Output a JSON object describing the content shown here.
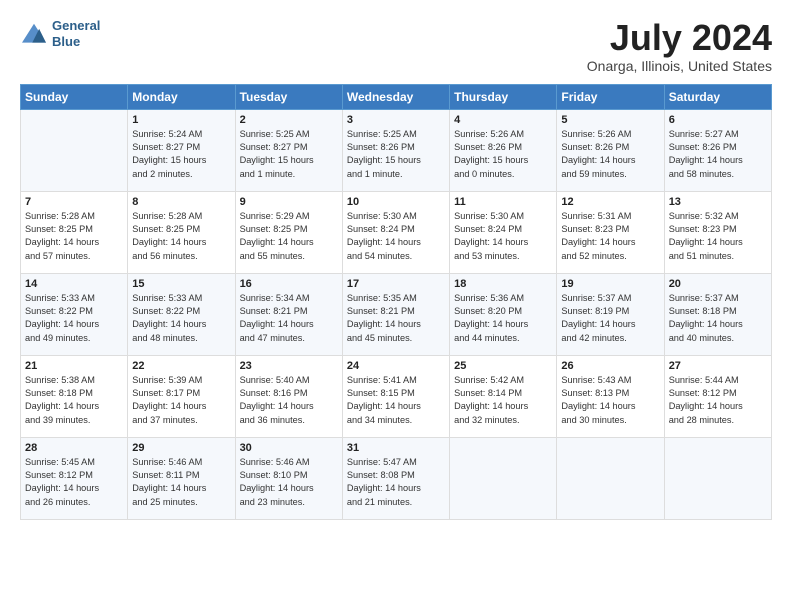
{
  "logo": {
    "line1": "General",
    "line2": "Blue"
  },
  "title": "July 2024",
  "subtitle": "Onarga, Illinois, United States",
  "days_header": [
    "Sunday",
    "Monday",
    "Tuesday",
    "Wednesday",
    "Thursday",
    "Friday",
    "Saturday"
  ],
  "weeks": [
    [
      {
        "day": "",
        "info": ""
      },
      {
        "day": "1",
        "info": "Sunrise: 5:24 AM\nSunset: 8:27 PM\nDaylight: 15 hours\nand 2 minutes."
      },
      {
        "day": "2",
        "info": "Sunrise: 5:25 AM\nSunset: 8:27 PM\nDaylight: 15 hours\nand 1 minute."
      },
      {
        "day": "3",
        "info": "Sunrise: 5:25 AM\nSunset: 8:26 PM\nDaylight: 15 hours\nand 1 minute."
      },
      {
        "day": "4",
        "info": "Sunrise: 5:26 AM\nSunset: 8:26 PM\nDaylight: 15 hours\nand 0 minutes."
      },
      {
        "day": "5",
        "info": "Sunrise: 5:26 AM\nSunset: 8:26 PM\nDaylight: 14 hours\nand 59 minutes."
      },
      {
        "day": "6",
        "info": "Sunrise: 5:27 AM\nSunset: 8:26 PM\nDaylight: 14 hours\nand 58 minutes."
      }
    ],
    [
      {
        "day": "7",
        "info": "Sunrise: 5:28 AM\nSunset: 8:25 PM\nDaylight: 14 hours\nand 57 minutes."
      },
      {
        "day": "8",
        "info": "Sunrise: 5:28 AM\nSunset: 8:25 PM\nDaylight: 14 hours\nand 56 minutes."
      },
      {
        "day": "9",
        "info": "Sunrise: 5:29 AM\nSunset: 8:25 PM\nDaylight: 14 hours\nand 55 minutes."
      },
      {
        "day": "10",
        "info": "Sunrise: 5:30 AM\nSunset: 8:24 PM\nDaylight: 14 hours\nand 54 minutes."
      },
      {
        "day": "11",
        "info": "Sunrise: 5:30 AM\nSunset: 8:24 PM\nDaylight: 14 hours\nand 53 minutes."
      },
      {
        "day": "12",
        "info": "Sunrise: 5:31 AM\nSunset: 8:23 PM\nDaylight: 14 hours\nand 52 minutes."
      },
      {
        "day": "13",
        "info": "Sunrise: 5:32 AM\nSunset: 8:23 PM\nDaylight: 14 hours\nand 51 minutes."
      }
    ],
    [
      {
        "day": "14",
        "info": "Sunrise: 5:33 AM\nSunset: 8:22 PM\nDaylight: 14 hours\nand 49 minutes."
      },
      {
        "day": "15",
        "info": "Sunrise: 5:33 AM\nSunset: 8:22 PM\nDaylight: 14 hours\nand 48 minutes."
      },
      {
        "day": "16",
        "info": "Sunrise: 5:34 AM\nSunset: 8:21 PM\nDaylight: 14 hours\nand 47 minutes."
      },
      {
        "day": "17",
        "info": "Sunrise: 5:35 AM\nSunset: 8:21 PM\nDaylight: 14 hours\nand 45 minutes."
      },
      {
        "day": "18",
        "info": "Sunrise: 5:36 AM\nSunset: 8:20 PM\nDaylight: 14 hours\nand 44 minutes."
      },
      {
        "day": "19",
        "info": "Sunrise: 5:37 AM\nSunset: 8:19 PM\nDaylight: 14 hours\nand 42 minutes."
      },
      {
        "day": "20",
        "info": "Sunrise: 5:37 AM\nSunset: 8:18 PM\nDaylight: 14 hours\nand 40 minutes."
      }
    ],
    [
      {
        "day": "21",
        "info": "Sunrise: 5:38 AM\nSunset: 8:18 PM\nDaylight: 14 hours\nand 39 minutes."
      },
      {
        "day": "22",
        "info": "Sunrise: 5:39 AM\nSunset: 8:17 PM\nDaylight: 14 hours\nand 37 minutes."
      },
      {
        "day": "23",
        "info": "Sunrise: 5:40 AM\nSunset: 8:16 PM\nDaylight: 14 hours\nand 36 minutes."
      },
      {
        "day": "24",
        "info": "Sunrise: 5:41 AM\nSunset: 8:15 PM\nDaylight: 14 hours\nand 34 minutes."
      },
      {
        "day": "25",
        "info": "Sunrise: 5:42 AM\nSunset: 8:14 PM\nDaylight: 14 hours\nand 32 minutes."
      },
      {
        "day": "26",
        "info": "Sunrise: 5:43 AM\nSunset: 8:13 PM\nDaylight: 14 hours\nand 30 minutes."
      },
      {
        "day": "27",
        "info": "Sunrise: 5:44 AM\nSunset: 8:12 PM\nDaylight: 14 hours\nand 28 minutes."
      }
    ],
    [
      {
        "day": "28",
        "info": "Sunrise: 5:45 AM\nSunset: 8:12 PM\nDaylight: 14 hours\nand 26 minutes."
      },
      {
        "day": "29",
        "info": "Sunrise: 5:46 AM\nSunset: 8:11 PM\nDaylight: 14 hours\nand 25 minutes."
      },
      {
        "day": "30",
        "info": "Sunrise: 5:46 AM\nSunset: 8:10 PM\nDaylight: 14 hours\nand 23 minutes."
      },
      {
        "day": "31",
        "info": "Sunrise: 5:47 AM\nSunset: 8:08 PM\nDaylight: 14 hours\nand 21 minutes."
      },
      {
        "day": "",
        "info": ""
      },
      {
        "day": "",
        "info": ""
      },
      {
        "day": "",
        "info": ""
      }
    ]
  ]
}
